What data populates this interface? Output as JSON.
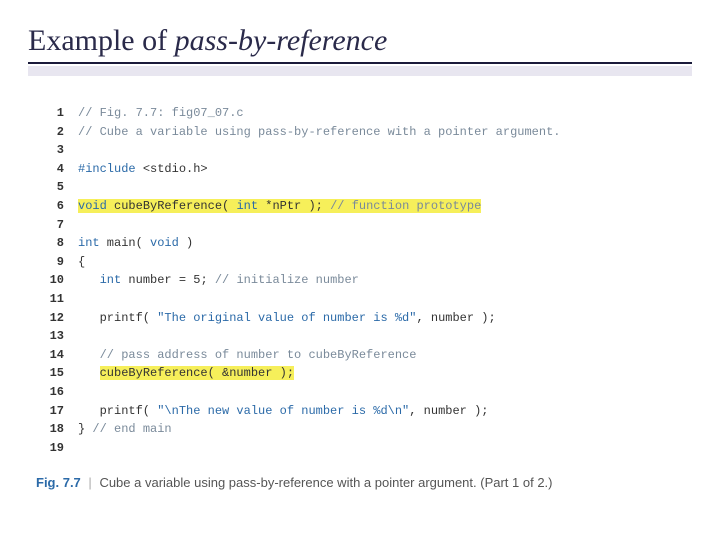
{
  "title": {
    "prefix": "Example of ",
    "italic": "pass-by-reference"
  },
  "code": {
    "lines": [
      {
        "n": "1",
        "segs": [
          {
            "cls": "cmt",
            "t": "// Fig. 7.7: fig07_07.c"
          }
        ]
      },
      {
        "n": "2",
        "segs": [
          {
            "cls": "cmt",
            "t": "// Cube a variable using pass-by-reference with a pointer argument."
          }
        ]
      },
      {
        "n": "3",
        "segs": []
      },
      {
        "n": "4",
        "segs": [
          {
            "cls": "kw",
            "t": "#include "
          },
          {
            "cls": "txt",
            "t": "<stdio.h>"
          }
        ]
      },
      {
        "n": "5",
        "segs": []
      },
      {
        "n": "6",
        "segs": [
          {
            "cls": "kw hl",
            "t": "void"
          },
          {
            "cls": "txt hl",
            "t": " cubeByReference( "
          },
          {
            "cls": "kw hl",
            "t": "int"
          },
          {
            "cls": "txt hl",
            "t": " *nPtr ); "
          },
          {
            "cls": "cmt hl",
            "t": "// function prototype"
          }
        ]
      },
      {
        "n": "7",
        "segs": []
      },
      {
        "n": "8",
        "segs": [
          {
            "cls": "kw",
            "t": "int"
          },
          {
            "cls": "txt",
            "t": " main( "
          },
          {
            "cls": "kw",
            "t": "void"
          },
          {
            "cls": "txt",
            "t": " )"
          }
        ]
      },
      {
        "n": "9",
        "segs": [
          {
            "cls": "txt",
            "t": "{"
          }
        ]
      },
      {
        "n": "10",
        "segs": [
          {
            "cls": "txt",
            "t": "   "
          },
          {
            "cls": "kw",
            "t": "int"
          },
          {
            "cls": "txt",
            "t": " number = "
          },
          {
            "cls": "num",
            "t": "5"
          },
          {
            "cls": "txt",
            "t": "; "
          },
          {
            "cls": "cmt",
            "t": "// initialize number"
          }
        ]
      },
      {
        "n": "11",
        "segs": []
      },
      {
        "n": "12",
        "segs": [
          {
            "cls": "txt",
            "t": "   printf( "
          },
          {
            "cls": "str",
            "t": "\"The original value of number is %d\""
          },
          {
            "cls": "txt",
            "t": ", number );"
          }
        ]
      },
      {
        "n": "13",
        "segs": []
      },
      {
        "n": "14",
        "segs": [
          {
            "cls": "txt",
            "t": "   "
          },
          {
            "cls": "cmt",
            "t": "// pass address of number to cubeByReference"
          }
        ]
      },
      {
        "n": "15",
        "segs": [
          {
            "cls": "txt",
            "t": "   "
          },
          {
            "cls": "txt hl",
            "t": "cubeByReference( &number );"
          }
        ]
      },
      {
        "n": "16",
        "segs": []
      },
      {
        "n": "17",
        "segs": [
          {
            "cls": "txt",
            "t": "   printf( "
          },
          {
            "cls": "str",
            "t": "\"\\nThe new value of number is %d\\n\""
          },
          {
            "cls": "txt",
            "t": ", number );"
          }
        ]
      },
      {
        "n": "18",
        "segs": [
          {
            "cls": "txt",
            "t": "} "
          },
          {
            "cls": "cmt",
            "t": "// end main"
          }
        ]
      },
      {
        "n": "19",
        "segs": []
      }
    ]
  },
  "caption": {
    "label": "Fig. 7.7",
    "text": "Cube a variable using pass-by-reference with a pointer argument. (Part 1 of 2.)"
  }
}
